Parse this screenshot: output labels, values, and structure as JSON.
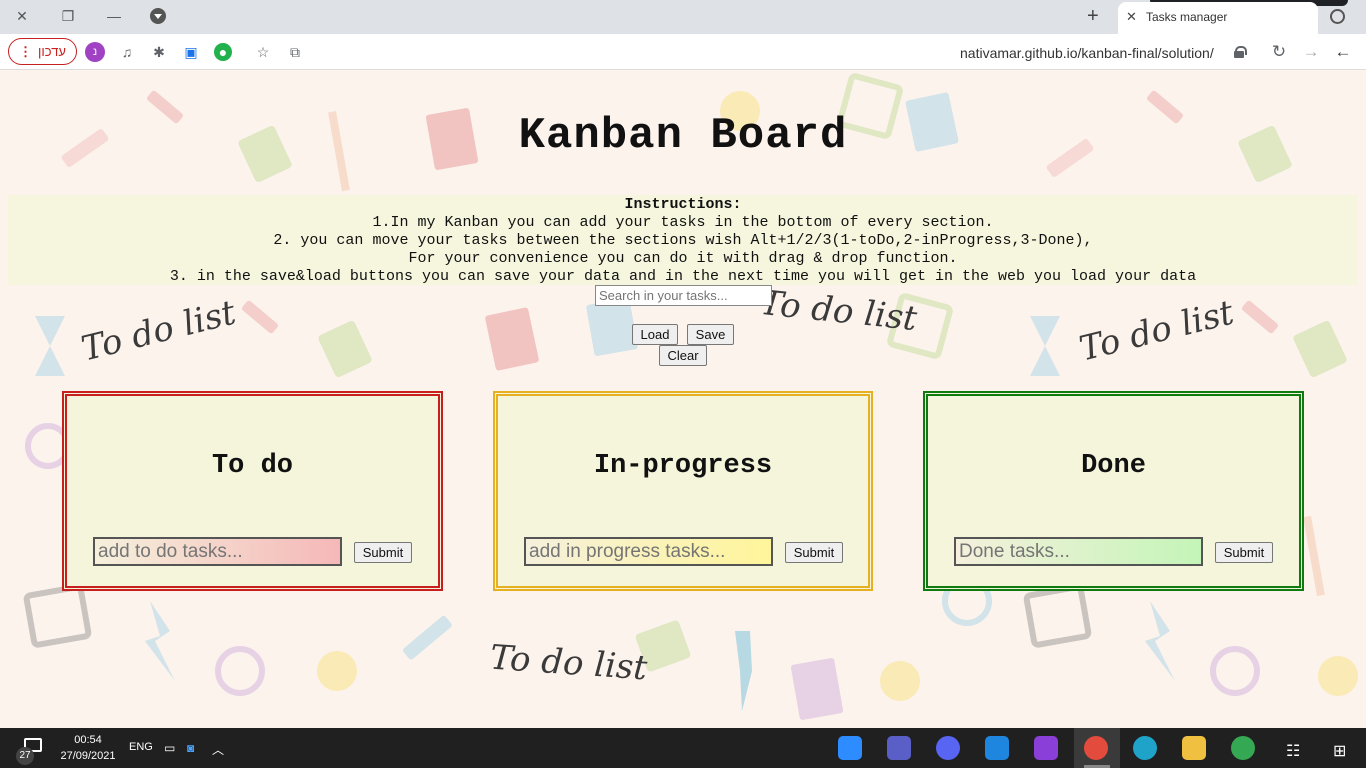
{
  "browser": {
    "tab_title": "Tasks manager",
    "url": "nativamar.github.io/kanban-final/solution/",
    "update_label": "עדכון",
    "profile_initial": "נ"
  },
  "page": {
    "title": "Kanban Board",
    "instructions": {
      "heading": "Instructions:",
      "line1": "1.In my Kanban you can add your tasks in the bottom of every section.",
      "line2": "2. you can move your tasks between the sections wish Alt+1/2/3(1-toDo,2-inProgress,3-Done),",
      "line3": "For your convenience you can do it with drag & drop function.",
      "line4": "3. in the save&load buttons you can save your data and in the next time you will get in the web you load your data"
    },
    "search_placeholder": "Search in your tasks...",
    "load_label": "Load",
    "save_label": "Save",
    "clear_label": "Clear",
    "doodle_text": "To do list",
    "columns": [
      {
        "title": "To do",
        "placeholder": "add to do tasks...",
        "submit": "Submit",
        "border_color": "#c81e1e",
        "input_gradient": [
          "#f5f0dc",
          "#f5b8b8"
        ]
      },
      {
        "title": "In-progress",
        "placeholder": "add in progress tasks...",
        "submit": "Submit",
        "border_color": "#e6b020",
        "input_gradient": [
          "#f5f0dc",
          "#fff59a"
        ]
      },
      {
        "title": "Done",
        "placeholder": "Done tasks...",
        "submit": "Submit",
        "border_color": "#0f7a0f",
        "input_gradient": [
          "#f5f0dc",
          "#c4f5b8"
        ]
      }
    ]
  },
  "taskbar": {
    "notification_count": "27",
    "time": "00:54",
    "date": "27/09/2021",
    "language": "ENG"
  }
}
